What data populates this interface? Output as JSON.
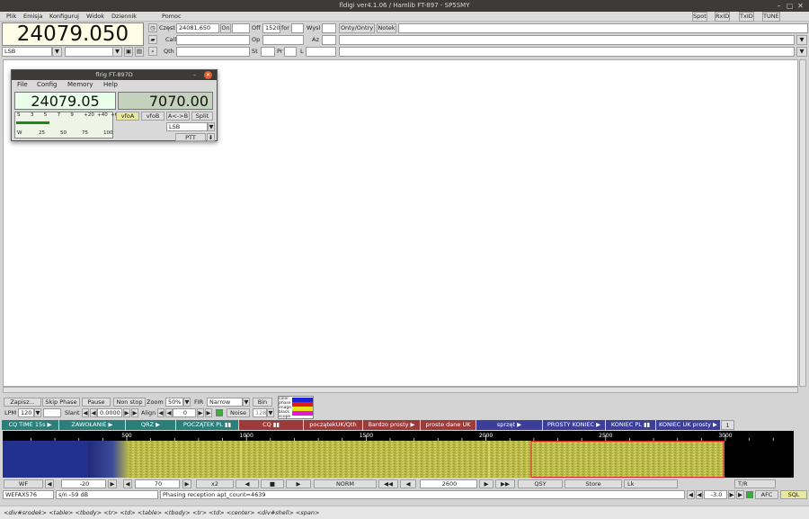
{
  "window": {
    "title": "fldigi ver4.1.06 / Hamlib FT-897 - SP5SMY"
  },
  "menu": {
    "items": [
      "Plik",
      "Emisja",
      "Konfiguruj",
      "Widok",
      "Dziennik",
      "Pomoc"
    ]
  },
  "top_right": {
    "spot": "Spot",
    "rxid": "RxID",
    "txid": "TxID",
    "tune": "TUNE"
  },
  "freq": {
    "display": "24079.050",
    "mode": "LSB"
  },
  "log": {
    "czest_label": "Częst",
    "czest_value": "24081.650",
    "on_label": "On",
    "off_label": "Off",
    "off_value": "1520",
    "for_label": "for",
    "wysl_label": "Wysl",
    "onty_label": "Onty/Ontry",
    "notek_label": "Notek",
    "call_label": "Call",
    "op_label": "Op",
    "az_label": "Az",
    "qth_label": "Qth",
    "st_label": "St",
    "pr_label": "Pr",
    "l_label": "L"
  },
  "flrig": {
    "title": "flrig FT-897D",
    "menu": [
      "File",
      "Config",
      "Memory",
      "Help"
    ],
    "vfoa": "24079.05",
    "vfob": "7070.00",
    "smeter_ticks": [
      "S",
      "3",
      "5",
      "7",
      "9",
      "+20",
      "+40",
      "+60"
    ],
    "power_ticks": [
      "W",
      "25",
      "50",
      "75",
      "100"
    ],
    "vfoa_btn": "vfoA",
    "vfob_btn": "vfoB",
    "swap_btn": "A<->B",
    "split_btn": "Split",
    "mode": "LSB",
    "ptt": "PTT"
  },
  "controls": {
    "zapisz": "Zapisz...",
    "skip_phase": "Skip Phase",
    "pause": "Pause",
    "non_stop": "Non stop",
    "zoom_label": "Zoom",
    "zoom_value": "50%",
    "fir_label": "FIR",
    "fir_value": "Narrow",
    "bin": "Bin",
    "lpm_label": "LPM",
    "lpm_value": "120",
    "slant_label": "Slant",
    "slant_value": "0.0000",
    "align_label": "Align",
    "align_value": "0",
    "noise": "Noise",
    "noise_value": "128",
    "legend": [
      "color",
      "phase",
      "image",
      "black",
      "scope"
    ]
  },
  "macros": [
    "CQ TIME 15s ▶",
    "ZAWOŁANIE ▶",
    "QRZ ▶",
    "POCZĄTEK PL ▮▮",
    "CQ ▮▮",
    "początekUK/Qth",
    "Bardzo prosty ▶",
    "proste dane UK",
    "sprzęt ▶",
    "PROSTY KONIEC ▶",
    "KONIEC PL ▮▮",
    "KONIEC UK prosty ▶",
    "1"
  ],
  "scale": {
    "ticks": [
      "500",
      "1000",
      "1500",
      "2000",
      "2500",
      "3000"
    ]
  },
  "wfctrl": {
    "wf": "WF",
    "min": "-20",
    "range": "70",
    "x2": "x2",
    "norm": "NORM",
    "freq": "2600",
    "qsy": "QSY",
    "store": "Store",
    "lk": "Lk",
    "tr": "T/R"
  },
  "status": {
    "mode": "WEFAX576",
    "sn": "s/n -59 dB",
    "msg": "Phasing reception apt_count=4639",
    "val": "-3.0",
    "afc": "AFC",
    "sql": "SQL"
  },
  "crumbs": "<div#srodek> <table> <tbody> <tr> <td> <table> <tbody> <tr> <td> <center> <div#shell> <span>",
  "colors": {
    "accent": "#3c3b37",
    "macro_teal": "#2b7f7a",
    "macro_red": "#9d3a3a",
    "macro_blue": "#3b3f9a",
    "wf_blue": "#202b78",
    "wf_yellow": "#c8c84a"
  }
}
